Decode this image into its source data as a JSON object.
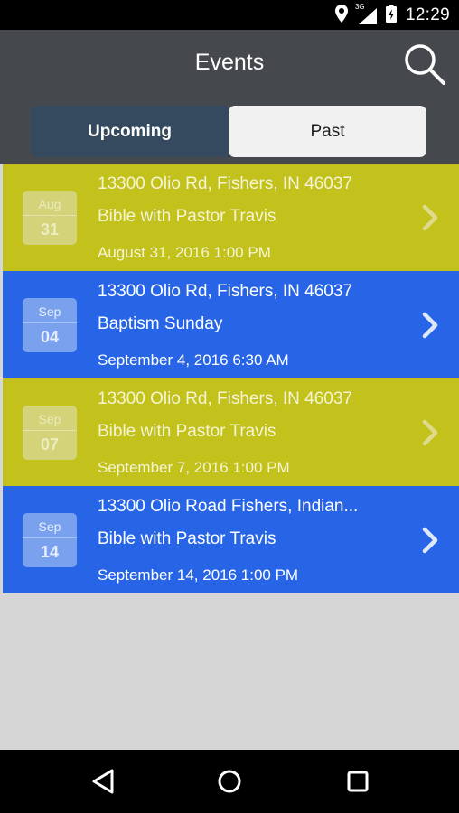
{
  "status_bar": {
    "time": "12:29",
    "network": "3G",
    "icons": [
      "location-pin-icon",
      "signal-icon",
      "battery-icon"
    ]
  },
  "app_bar": {
    "title": "Events",
    "search_icon": "search-icon"
  },
  "tabs": {
    "upcoming_label": "Upcoming",
    "past_label": "Past",
    "selected": "Past"
  },
  "events": [
    {
      "address": "13300 Olio Rd, Fishers, IN 46037",
      "title": "Bible with Pastor Travis",
      "datetime": "August 31, 2016 1:00 PM",
      "badge_month": "Aug",
      "badge_day": "31",
      "color": "#c3c11b"
    },
    {
      "address": "13300 Olio Rd, Fishers, IN 46037",
      "title": "Baptism Sunday",
      "datetime": "September 4, 2016 6:30 AM",
      "badge_month": "Sep",
      "badge_day": "04",
      "color": "#2765e6"
    },
    {
      "address": "13300 Olio Rd, Fishers, IN 46037",
      "title": "Bible with Pastor Travis",
      "datetime": "September 7, 2016 1:00 PM",
      "badge_month": "Sep",
      "badge_day": "07",
      "color": "#c3c11b"
    },
    {
      "address": "13300 Olio Road Fishers, Indian...",
      "title": "Bible with Pastor Travis",
      "datetime": "September 14, 2016 1:00 PM",
      "badge_month": "Sep",
      "badge_day": "14",
      "color": "#2765e6"
    }
  ],
  "nav_bar": {
    "icons": [
      "back-icon",
      "home-icon",
      "recent-apps-icon"
    ]
  },
  "colors": {
    "app_bar": "#45484d",
    "segment_active": "#354a5e",
    "row_olive": "#c3c11b",
    "row_blue": "#2765e6",
    "empty_area": "#d6d6d6"
  }
}
